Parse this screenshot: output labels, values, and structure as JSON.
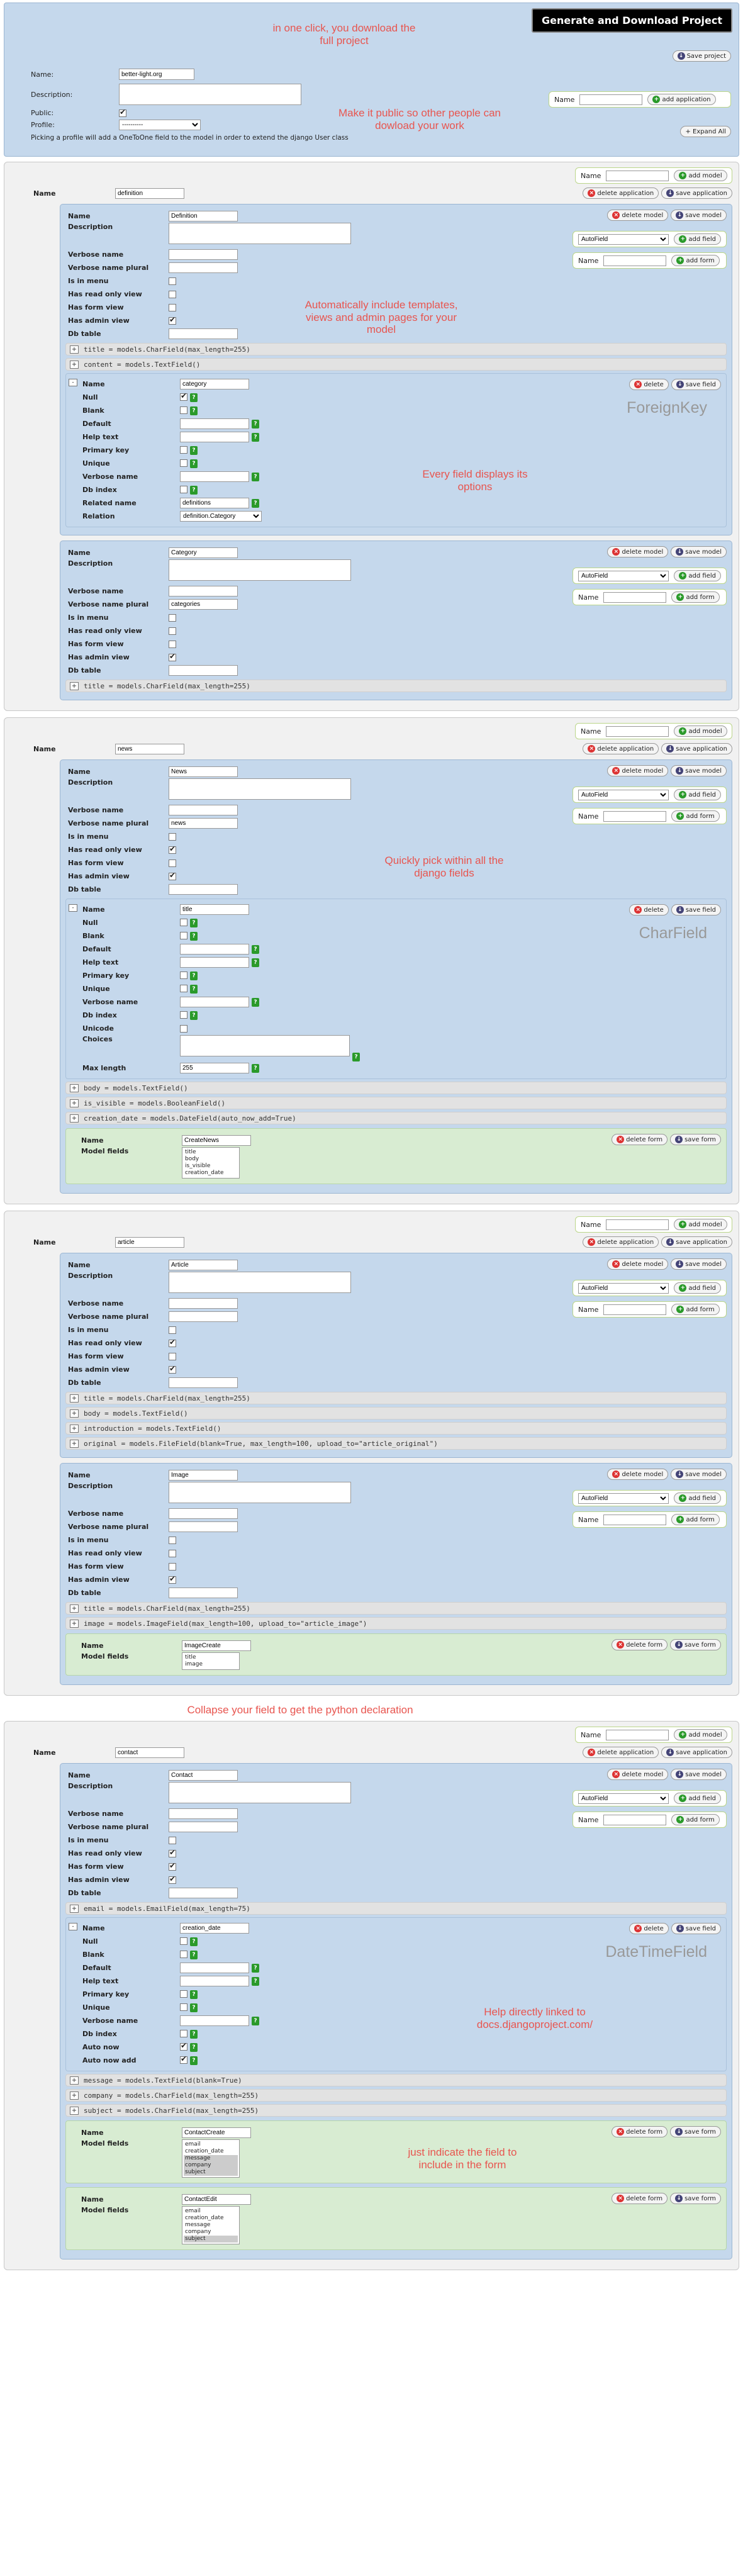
{
  "project": {
    "generate_label": "Generate and Download Project",
    "save_label": "Save project",
    "name_label": "Name:",
    "name_value": "better-light.org",
    "description_label": "Description:",
    "public_label": "Public:",
    "profile_label": "Profile:",
    "profile_value": "----------",
    "profile_note": "Picking a profile will add a OneToOne field to the model in order to extend the django User class",
    "add_app_name_label": "Name",
    "add_app_label": "add application",
    "expand_label": "+ Expand All"
  },
  "annotations": {
    "download": "in one click, you download the full project",
    "public": "Make it public so other people can dowload your work",
    "templates": "Automatically include templates, views and admin pages for your model",
    "options": "Every field displays its options",
    "pick": "Quickly pick within all the django fields",
    "collapse": "Collapse your field to get the python declaration",
    "help": "Help directly linked to docs.djangoproject.com/",
    "include": "just indicate the field to include in the form"
  },
  "common": {
    "name": "Name",
    "description": "Description",
    "verbose_name": "Verbose name",
    "verbose_plural": "Verbose name plural",
    "is_in_menu": "Is in menu",
    "ro": "Has read only view",
    "form_view": "Has form view",
    "admin_view": "Has admin view",
    "db_table": "Db table",
    "delete_app": "delete application",
    "save_app": "save application",
    "add_model": "add model",
    "delete_model": "delete model",
    "save_model": "save model",
    "add_field": "add field",
    "add_form": "add form",
    "field_type": "AutoField",
    "delete": "delete",
    "save_field": "save field",
    "delete_form": "delete form",
    "save_form": "save form",
    "model_fields": "Model fields",
    "null": "Null",
    "blank": "Blank",
    "default": "Default",
    "help_text": "Help text",
    "primary_key": "Primary key",
    "unique": "Unique",
    "db_index": "Db index",
    "related_name": "Related name",
    "relation": "Relation",
    "unicode": "Unicode",
    "choices": "Choices",
    "max_length": "Max length",
    "auto_now": "Auto now",
    "auto_now_add": "Auto now add"
  },
  "apps": [
    {
      "name": "definition",
      "models": [
        {
          "name": "Definition",
          "plural": "",
          "ro": false,
          "form": false,
          "admin": true,
          "lines_before": [
            "title = models.CharField(max_length=255)",
            "content = models.TextField()"
          ],
          "field": {
            "kind": "fk",
            "type_label": "ForeignKey",
            "name": "category",
            "null": true,
            "blank": false,
            "pk": false,
            "unique": false,
            "db_index": false,
            "related_name": "definitions",
            "relation": "definition.Category"
          },
          "lines_after": [],
          "forms": []
        },
        {
          "name": "Category",
          "plural": "categories",
          "ro": false,
          "form": false,
          "admin": true,
          "lines_before": [
            "title = models.CharField(max_length=255)"
          ],
          "field": null,
          "lines_after": [],
          "forms": []
        }
      ]
    },
    {
      "name": "news",
      "models": [
        {
          "name": "News",
          "plural": "news",
          "ro": true,
          "form": false,
          "admin": true,
          "lines_before": [],
          "field": {
            "kind": "char",
            "type_label": "CharField",
            "name": "title",
            "null": false,
            "blank": false,
            "pk": false,
            "unique": false,
            "db_index": false,
            "unicode": false,
            "max_length": "255"
          },
          "lines_after": [
            "body = models.TextField()",
            "is_visible = models.BooleanField()",
            "creation_date = models.DateField(auto_now_add=True)"
          ],
          "forms": [
            {
              "name": "CreateNews",
              "fields": [
                "title",
                "body",
                "is_visible",
                "creation_date"
              ],
              "sel": []
            }
          ]
        }
      ]
    },
    {
      "name": "article",
      "models": [
        {
          "name": "Article",
          "plural": "",
          "ro": true,
          "form": false,
          "admin": true,
          "lines_before": [
            "title = models.CharField(max_length=255)",
            "body = models.TextField()",
            "introduction = models.TextField()",
            "original = models.FileField(blank=True, max_length=100, upload_to=\"article_original\")"
          ],
          "field": null,
          "lines_after": [],
          "forms": []
        },
        {
          "name": "Image",
          "plural": "",
          "ro": false,
          "form": false,
          "admin": true,
          "lines_before": [
            "title = models.CharField(max_length=255)",
            "image = models.ImageField(max_length=100, upload_to=\"article_image\")"
          ],
          "field": null,
          "lines_after": [],
          "forms": [
            {
              "name": "ImageCreate",
              "fields": [
                "title",
                "image"
              ],
              "sel": []
            }
          ]
        }
      ]
    },
    {
      "name": "contact",
      "models": [
        {
          "name": "Contact",
          "plural": "",
          "ro": true,
          "form": true,
          "admin": true,
          "lines_before": [
            "email = models.EmailField(max_length=75)"
          ],
          "field": {
            "kind": "dt",
            "type_label": "DateTimeField",
            "name": "creation_date",
            "null": false,
            "blank": false,
            "pk": false,
            "unique": false,
            "db_index": false,
            "auto_now": true,
            "auto_now_add": true
          },
          "lines_after": [
            "message = models.TextField(blank=True)",
            "company = models.CharField(max_length=255)",
            "subject = models.CharField(max_length=255)"
          ],
          "forms": [
            {
              "name": "ContactCreate",
              "fields": [
                "email",
                "creation_date",
                "message",
                "company",
                "subject"
              ],
              "sel": [
                "message",
                "company",
                "subject"
              ]
            },
            {
              "name": "ContactEdit",
              "fields": [
                "email",
                "creation_date",
                "message",
                "company",
                "subject"
              ],
              "sel": [
                "subject"
              ]
            }
          ]
        }
      ]
    }
  ]
}
